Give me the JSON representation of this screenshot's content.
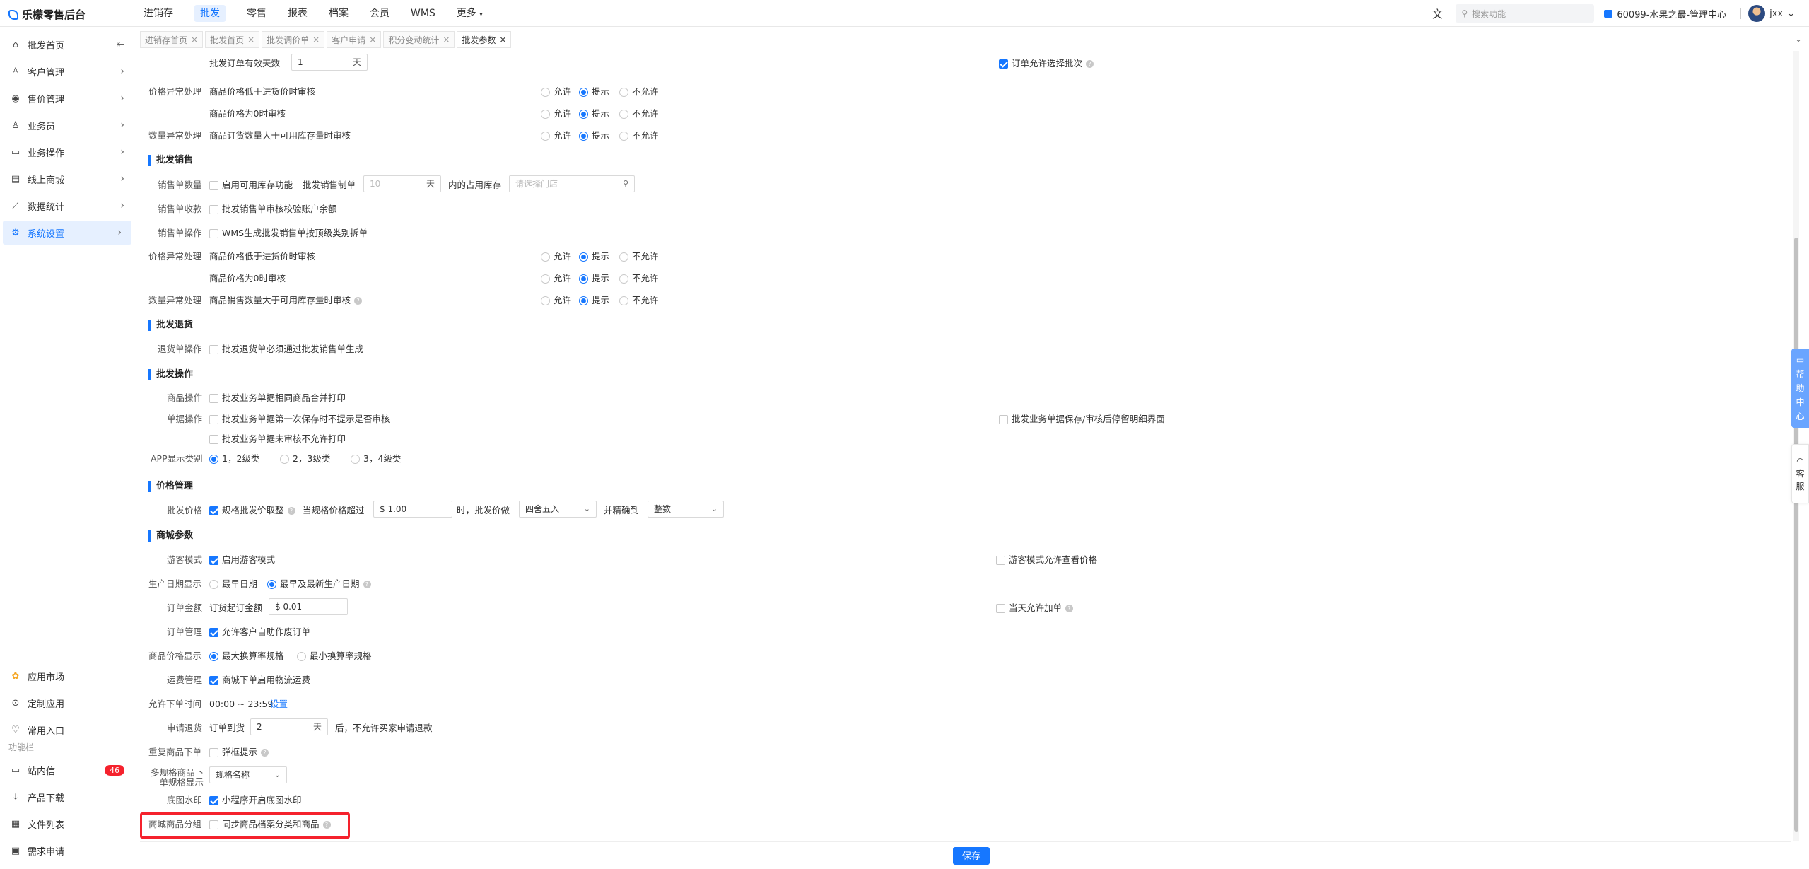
{
  "app": {
    "title": "乐檬零售后台"
  },
  "topnav": [
    "进销存",
    "批发",
    "零售",
    "报表",
    "档案",
    "会员",
    "WMS",
    "更多"
  ],
  "topnav_active": 1,
  "header": {
    "translate_icon": "translate-icon",
    "search_placeholder": "搜索功能",
    "store": "60099-水果之最-管理中心",
    "user": "jxx"
  },
  "sidebar": {
    "items": [
      {
        "label": "批发首页",
        "icon": "home-icon"
      },
      {
        "label": "客户管理",
        "icon": "user-icon"
      },
      {
        "label": "售价管理",
        "icon": "price-icon"
      },
      {
        "label": "业务员",
        "icon": "person-icon"
      },
      {
        "label": "业务操作",
        "icon": "briefcase-icon"
      },
      {
        "label": "线上商城",
        "icon": "shop-icon"
      },
      {
        "label": "数据统计",
        "icon": "chart-icon"
      },
      {
        "label": "系统设置",
        "icon": "settings-icon"
      }
    ],
    "bottom_items": [
      {
        "label": "应用市场",
        "icon": "market-icon"
      },
      {
        "label": "定制应用",
        "icon": "custom-app-icon"
      },
      {
        "label": "常用入口",
        "icon": "heart-icon"
      }
    ],
    "section_label": "功能栏",
    "func_items": [
      {
        "label": "站内信",
        "icon": "message-icon",
        "badge": "46"
      },
      {
        "label": "产品下载",
        "icon": "download-icon"
      },
      {
        "label": "文件列表",
        "icon": "file-icon"
      },
      {
        "label": "需求申请",
        "icon": "request-icon"
      }
    ]
  },
  "tabs": [
    "进销存首页",
    "批发首页",
    "批发调价单",
    "客户申请",
    "积分变动统计",
    "批发参数"
  ],
  "form": {
    "r1_label": "批发订单有效天数",
    "r1_value": "1",
    "r1_unit": "天",
    "r1_right": "订单允许选择批次",
    "allow": "允许",
    "prompt": "提示",
    "disallow": "不允许",
    "price_abn": "价格异常处理",
    "price_low": "商品价格低于进货价时审核",
    "price_zero": "商品价格为0时审核",
    "qty_abn": "数量异常处理",
    "qty_order": "商品订货数量大于可用库存量时审核",
    "sec_sales": "批发销售",
    "sales_qty": "销售单数量",
    "enable_stock": "启用可用库存功能",
    "sales_order_make": "批发销售制单",
    "sales_days_ph": "10",
    "occupy": "内的占用库存",
    "store_ph": "请选择门店",
    "sales_collect": "销售单收款",
    "sales_collect_opt": "批发销售单审核校验账户余额",
    "sales_op": "销售单操作",
    "sales_op_opt": "WMS生成批发销售单按顶级类别拆单",
    "qty_sales": "商品销售数量大于可用库存量时审核",
    "sec_return": "批发退货",
    "return_op": "退货单操作",
    "return_opt": "批发退货单必须通过批发销售单生成",
    "sec_ops": "批发操作",
    "goods_op": "商品操作",
    "goods_op_opt": "批发业务单据相同商品合并打印",
    "doc_op": "单据操作",
    "doc_op_1": "批发业务单据第一次保存时不提示是否审核",
    "doc_op_2": "批发业务单据未审核不允许打印",
    "doc_op_right": "批发业务单据保存/审核后停留明细界面",
    "app_cat": "APP显示类别",
    "cat_12": "1，2级类",
    "cat_23": "2，3级类",
    "cat_34": "3，4级类",
    "sec_price": "价格管理",
    "whole_price": "批发价格",
    "spec_round": "规格批发价取整",
    "when_exceed": "当规格价格超过",
    "exceed_value": "$ 1.00",
    "then_price": "时，批发价做",
    "round_mode": "四舍五入",
    "precise_to": "并精确到",
    "precision": "整数",
    "sec_mall": "商城参数",
    "guest_mode": "游客模式",
    "enable_guest": "启用游客模式",
    "guest_price": "游客模式允许查看价格",
    "prod_date": "生产日期显示",
    "earliest": "最早日期",
    "earliest_latest": "最早及最新生产日期",
    "order_amt": "订单金额",
    "min_amt": "订货起订金额",
    "min_amt_value": "$ 0.01",
    "same_day": "当天允许加单",
    "order_mgmt": "订单管理",
    "self_cancel": "允许客户自助作废订单",
    "price_disp": "商品价格显示",
    "max_rate": "最大换算率规格",
    "min_rate": "最小换算率规格",
    "freight": "运费管理",
    "logistics": "商城下单启用物流运费",
    "order_time": "允许下单时间",
    "time_range": "00:00 ~ 23:59",
    "set_link": "设置",
    "refund": "申请退货",
    "order_arrive": "订单到货",
    "refund_days": "2",
    "refund_tail": "后，不允许买家申请退款",
    "repeat_order": "重复商品下单",
    "popup_hint": "弹框提示",
    "multi_spec_1": "多规格商品下",
    "multi_spec_2": "单规格显示",
    "spec_name": "规格名称",
    "watermark": "底图水印",
    "mini_watermark": "小程序开启底图水印",
    "mall_group": "商城商品分组",
    "sync_group": "同步商品档案分类和商品"
  },
  "footer": {
    "save": "保存"
  },
  "help": {
    "chars": [
      "帮",
      "助",
      "中",
      "心"
    ],
    "service": [
      "客",
      "服"
    ]
  },
  "colors": {
    "accent": "#1677ff",
    "highlight": "#f5222d"
  }
}
